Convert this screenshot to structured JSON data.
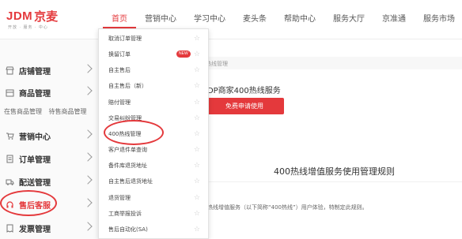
{
  "logo": {
    "brand": "JDM",
    "brand_cn": "京麦",
    "tagline": "开放 · 服务 · 中心"
  },
  "nav": {
    "items": [
      {
        "label": "首页",
        "active": true
      },
      {
        "label": "营销中心",
        "active": false
      },
      {
        "label": "学习中心",
        "active": false
      },
      {
        "label": "麦头条",
        "active": false
      },
      {
        "label": "帮助中心",
        "active": false
      },
      {
        "label": "服务大厅",
        "active": false
      },
      {
        "label": "京准通",
        "active": false
      },
      {
        "label": "服务市场",
        "active": false
      }
    ]
  },
  "sidebar": {
    "items": [
      {
        "label": "店铺管理",
        "icon": "store-icon"
      },
      {
        "label": "商品管理",
        "icon": "box-icon"
      },
      {
        "label": "营销中心",
        "icon": "cart-icon"
      },
      {
        "label": "订单管理",
        "icon": "order-icon"
      },
      {
        "label": "配送管理",
        "icon": "truck-icon"
      },
      {
        "label": "售后客服",
        "icon": "headset-icon"
      },
      {
        "label": "发票管理",
        "icon": "invoice-icon"
      }
    ],
    "subs": [
      "在售商品管理",
      "待售商品管理"
    ]
  },
  "dropdown": {
    "items": [
      {
        "label": "取消订单管理"
      },
      {
        "label": "换留订单",
        "badge": "NEW"
      },
      {
        "label": "自主售后"
      },
      {
        "label": "自主售后（新）"
      },
      {
        "label": "赔付管理"
      },
      {
        "label": "交易纠纷管理"
      },
      {
        "label": "400热线管理"
      },
      {
        "label": "客户退件单查询"
      },
      {
        "label": "备件库退货地址"
      },
      {
        "label": "自主售后退货地址"
      },
      {
        "label": "退货管理"
      },
      {
        "label": "工商举报投诉"
      },
      {
        "label": "售后自动化(SA)"
      }
    ]
  },
  "main": {
    "breadcrumb": "热线管理",
    "service_title": "JDP商家400热线服务",
    "apply_button": "免费申请使用",
    "rules_title": "400热线增值服务使用管理规则",
    "rules_text": "热线增值服务（以下简称“400热线”）用户体验，特制定此规则。"
  },
  "colors": {
    "accent": "#e4393c"
  }
}
